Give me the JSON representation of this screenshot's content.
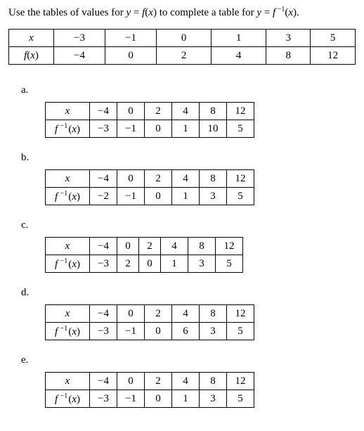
{
  "prompt": {
    "lead": "Use the tables of values for ",
    "eq1_lhs": "y",
    "eq1_eq": " = ",
    "eq1_rhs_f": "f",
    "eq1_paren": "(",
    "eq1_x": "x",
    "eq1_close": ")",
    "mid": " to complete a table for ",
    "eq2_lhs": "y",
    "eq2_eq": " = ",
    "eq2_f": "f",
    "eq2_sup": " −1",
    "eq2_paren": "(",
    "eq2_x": "x",
    "eq2_close": ").",
    "trail": ""
  },
  "main": {
    "row1_label": "x",
    "row1": [
      "−3",
      "−1",
      "0",
      "1",
      "3",
      "5"
    ],
    "row2_label_f": "f",
    "row2_label_paren": "(",
    "row2_label_x": "x",
    "row2_label_close": ")",
    "row2": [
      "−4",
      "0",
      "2",
      "4",
      "8",
      "12"
    ]
  },
  "options": {
    "a": {
      "label": "a.",
      "x": [
        "−4",
        "0",
        "2",
        "4",
        "8",
        "12"
      ],
      "y": [
        "−3",
        "−1",
        "0",
        "1",
        "10",
        "5"
      ]
    },
    "b": {
      "label": "b.",
      "x": [
        "−4",
        "0",
        "2",
        "4",
        "8",
        "12"
      ],
      "y": [
        "−2",
        "−1",
        "0",
        "1",
        "3",
        "5"
      ]
    },
    "c": {
      "label": "c.",
      "x": [
        "−4",
        "0",
        "2",
        "4",
        "8",
        "12"
      ],
      "y": [
        "−3",
        "2",
        "0",
        "1",
        "3",
        "5"
      ]
    },
    "d": {
      "label": "d.",
      "x": [
        "−4",
        "0",
        "2",
        "4",
        "8",
        "12"
      ],
      "y": [
        "−3",
        "−1",
        "0",
        "6",
        "3",
        "5"
      ]
    },
    "e": {
      "label": "e.",
      "x": [
        "−4",
        "0",
        "2",
        "4",
        "8",
        "12"
      ],
      "y": [
        "−3",
        "−1",
        "0",
        "1",
        "3",
        "5"
      ]
    }
  },
  "labels": {
    "x": "x",
    "f": "f",
    "x_var": "x",
    "sup": " −1",
    "open": "(",
    "close": ")"
  },
  "chart_data": [
    {
      "type": "table",
      "title": "Given f(x)",
      "columns": [
        "x",
        "f(x)"
      ],
      "rows": [
        [
          -3,
          -4
        ],
        [
          -1,
          0
        ],
        [
          0,
          2
        ],
        [
          1,
          4
        ],
        [
          3,
          8
        ],
        [
          5,
          12
        ]
      ]
    },
    {
      "type": "table",
      "title": "Option a f^{-1}(x)",
      "columns": [
        "x",
        "f^{-1}(x)"
      ],
      "rows": [
        [
          -4,
          -3
        ],
        [
          0,
          -1
        ],
        [
          2,
          0
        ],
        [
          4,
          1
        ],
        [
          8,
          10
        ],
        [
          12,
          5
        ]
      ]
    },
    {
      "type": "table",
      "title": "Option b f^{-1}(x)",
      "columns": [
        "x",
        "f^{-1}(x)"
      ],
      "rows": [
        [
          -4,
          -2
        ],
        [
          0,
          -1
        ],
        [
          2,
          0
        ],
        [
          4,
          1
        ],
        [
          8,
          3
        ],
        [
          12,
          5
        ]
      ]
    },
    {
      "type": "table",
      "title": "Option c f^{-1}(x)",
      "columns": [
        "x",
        "f^{-1}(x)"
      ],
      "rows": [
        [
          -4,
          -3
        ],
        [
          0,
          2
        ],
        [
          2,
          0
        ],
        [
          4,
          1
        ],
        [
          8,
          3
        ],
        [
          12,
          5
        ]
      ]
    },
    {
      "type": "table",
      "title": "Option d f^{-1}(x)",
      "columns": [
        "x",
        "f^{-1}(x)"
      ],
      "rows": [
        [
          -4,
          -3
        ],
        [
          0,
          -1
        ],
        [
          2,
          0
        ],
        [
          4,
          6
        ],
        [
          8,
          3
        ],
        [
          12,
          5
        ]
      ]
    },
    {
      "type": "table",
      "title": "Option e f^{-1}(x)",
      "columns": [
        "x",
        "f^{-1}(x)"
      ],
      "rows": [
        [
          -4,
          -3
        ],
        [
          0,
          -1
        ],
        [
          2,
          0
        ],
        [
          4,
          1
        ],
        [
          8,
          3
        ],
        [
          12,
          5
        ]
      ]
    }
  ]
}
